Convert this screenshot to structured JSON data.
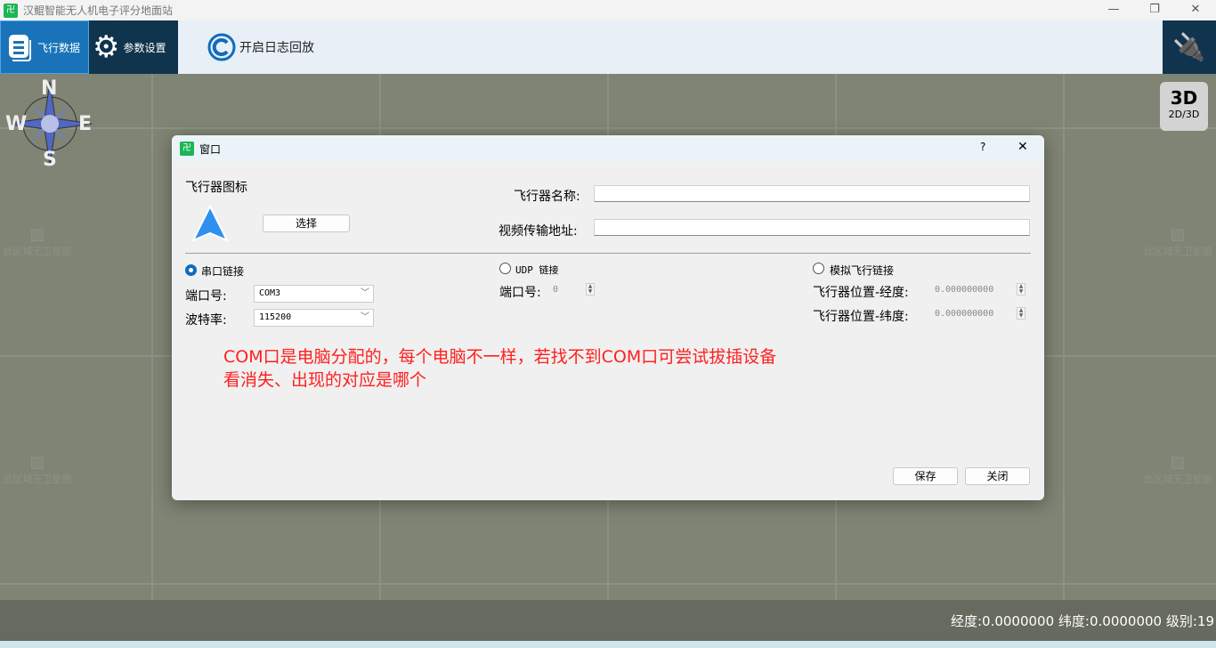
{
  "window": {
    "title": "汉鲲智能无人机电子评分地面站",
    "minimize": "—",
    "restore": "❐",
    "close": "✕"
  },
  "toolbar": {
    "flight_data": "飞行数据",
    "params": "参数设置",
    "log_replay": "开启日志回放"
  },
  "compass": {
    "n": "N",
    "s": "S",
    "e": "E",
    "w": "W"
  },
  "view_toggle": {
    "big": "3D",
    "small": "2D/3D"
  },
  "map": {
    "placeholder": "此区域无卫星图"
  },
  "status": {
    "text": "经度:0.0000000 纬度:0.0000000 级别:19"
  },
  "dialog": {
    "title": "窗口",
    "help": "?",
    "close": "✕",
    "icon_label": "飞行器图标",
    "select_button": "选择",
    "name_label": "飞行器名称:",
    "name_value": "",
    "video_label": "视频传输地址:",
    "video_value": "",
    "serial": {
      "label": "串口链接",
      "selected": true,
      "port_label": "端口号:",
      "port_value": "COM3",
      "baud_label": "波特率:",
      "baud_value": "115200"
    },
    "udp": {
      "label": "UDP 链接",
      "selected": false,
      "port_label": "端口号:",
      "port_value": "0"
    },
    "sim": {
      "label": "模拟飞行链接",
      "selected": false,
      "lon_label": "飞行器位置-经度:",
      "lon_value": "0.000000000",
      "lat_label": "飞行器位置-纬度:",
      "lat_value": "0.000000000"
    },
    "note_line1": "COM口是电脑分配的，每个电脑不一样，若找不到COM口可尝试拔插设备",
    "note_line2": "看消失、出现的对应是哪个",
    "note_color": "#ff2020",
    "save": "保存",
    "close_button": "关闭"
  }
}
